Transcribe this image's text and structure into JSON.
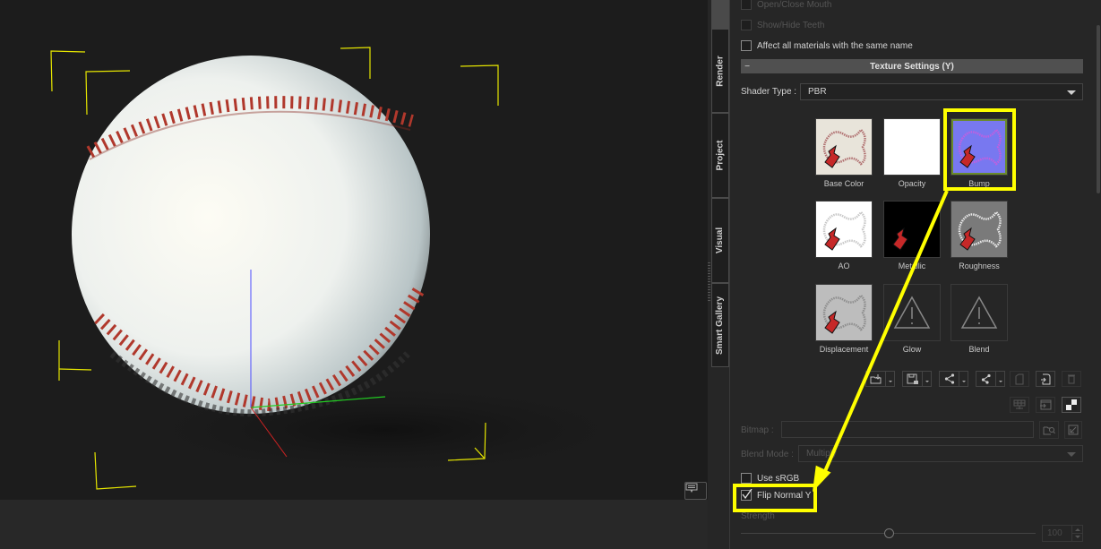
{
  "side_tabs": [
    "Render",
    "Project",
    "Visual",
    "Smart Gallery"
  ],
  "panel": {
    "checkboxes_top": [
      {
        "label": "Open/Close Mouth",
        "checked": false,
        "disabled": true
      },
      {
        "label": "Show/Hide Teeth",
        "checked": false,
        "disabled": true
      },
      {
        "label": "Affect all materials with the same name",
        "checked": false,
        "disabled": false
      }
    ],
    "section_title": "Texture Settings  (Y)",
    "section_toggle": "−",
    "shader_type_label": "Shader Type :",
    "shader_type_value": "PBR",
    "textures": [
      {
        "label": "Base Color",
        "kind": "base"
      },
      {
        "label": "Opacity",
        "kind": "opacity"
      },
      {
        "label": "Bump",
        "kind": "bump",
        "selected": true
      },
      {
        "label": "AO",
        "kind": "ao"
      },
      {
        "label": "Metallic",
        "kind": "metallic"
      },
      {
        "label": "Roughness",
        "kind": "roughness"
      },
      {
        "label": "Displacement",
        "kind": "displacement"
      },
      {
        "label": "Glow",
        "kind": "empty"
      },
      {
        "label": "Blend",
        "kind": "empty"
      }
    ],
    "toolbar_icons": [
      "load-texture-icon",
      "save-texture-icon",
      "share-icon",
      "share-alt-icon",
      "copy-icon",
      "paste-icon",
      "delete-icon",
      "uv-editor-icon",
      "launch-editor-icon",
      "checker-icon"
    ],
    "bitmap_label": "Bitmap :",
    "bitmap_value": "",
    "blend_mode_label": "Blend Mode :",
    "blend_mode_value": "Multiply",
    "use_srgb_label": "Use sRGB",
    "use_srgb_checked": false,
    "flip_normal_label": "Flip Normal Y",
    "flip_normal_checked": true,
    "strength_label": "Strength",
    "strength_value": "100",
    "strength_fraction": 0.5
  },
  "colors": {
    "highlight": "#ffff00",
    "panel_bg": "#262626",
    "viewport_bg": "#1c1c1c"
  }
}
